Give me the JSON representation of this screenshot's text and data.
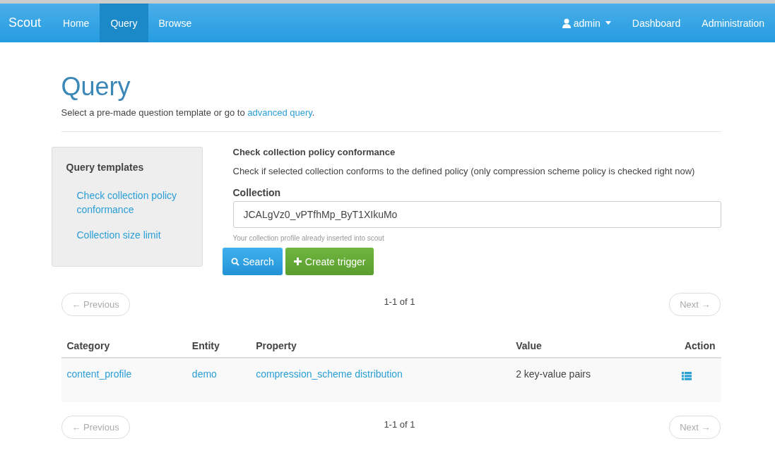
{
  "navbar": {
    "brand": "Scout",
    "items": [
      {
        "label": "Home",
        "selected": false
      },
      {
        "label": "Query",
        "selected": true
      },
      {
        "label": "Browse",
        "selected": false
      }
    ],
    "user": "admin",
    "right_items": [
      "Dashboard",
      "Administration"
    ]
  },
  "header": {
    "title": "Query",
    "subtitle_prefix": "Select a pre-made question template or go to ",
    "subtitle_link": "advanced query",
    "subtitle_suffix": "."
  },
  "sidebar": {
    "title": "Query templates",
    "items": [
      {
        "label": "Check collection policy conformance"
      },
      {
        "label": "Collection size limit"
      }
    ]
  },
  "form": {
    "title": "Check collection policy conformance",
    "description": "Check if selected collection conforms to the defined policy (only compression scheme policy is checked right now)",
    "field_label": "Collection",
    "field_value": "JCALgVz0_vPTfhMp_ByT1XIkuMo",
    "help": "Your collection profile already inserted into scout",
    "buttons": [
      {
        "kind": "search",
        "label": "Search"
      },
      {
        "kind": "create",
        "label": "Create trigger"
      }
    ]
  },
  "pager_top": {
    "previous": "← Previous",
    "count": "1-1 of 1",
    "next": "Next →"
  },
  "table": {
    "columns": [
      "Category",
      "Entity",
      "Property",
      "Value",
      "Action"
    ],
    "rows": [
      {
        "category": "content_profile",
        "entity": "demo",
        "property": "compression_scheme distribution",
        "value": "2 key-value pairs"
      }
    ]
  },
  "pager_bottom": {
    "previous": "← Previous",
    "count": "1-1 of 1",
    "next": "Next →"
  }
}
